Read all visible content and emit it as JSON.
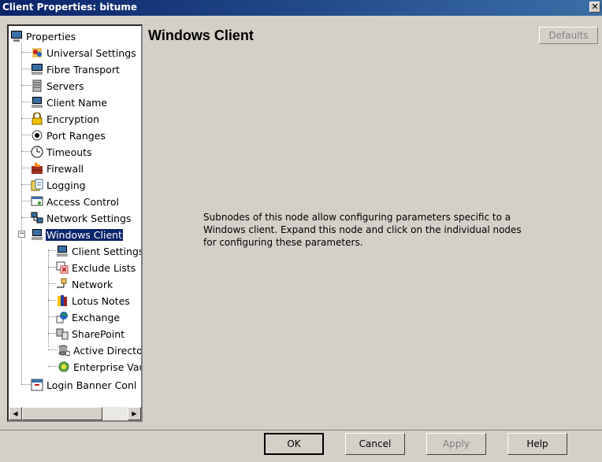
{
  "window": {
    "title": "Client Properties: bitume"
  },
  "tree": {
    "items": [
      {
        "label": "Properties",
        "icon": "computer-icon"
      },
      {
        "label": "Universal Settings",
        "icon": "settings-icon"
      },
      {
        "label": "Fibre Transport",
        "icon": "monitor-icon"
      },
      {
        "label": "Servers",
        "icon": "servers-icon"
      },
      {
        "label": "Client Name",
        "icon": "computer-icon"
      },
      {
        "label": "Encryption",
        "icon": "lock-icon"
      },
      {
        "label": "Port Ranges",
        "icon": "radio-icon"
      },
      {
        "label": "Timeouts",
        "icon": "clock-icon"
      },
      {
        "label": "Firewall",
        "icon": "firewall-icon"
      },
      {
        "label": "Logging",
        "icon": "log-icon"
      },
      {
        "label": "Access Control",
        "icon": "access-control-icon"
      },
      {
        "label": "Network Settings",
        "icon": "network-icon"
      },
      {
        "label": "Windows Client",
        "icon": "computer-icon"
      },
      {
        "label": "Client Settings",
        "icon": "computer-icon"
      },
      {
        "label": "Exclude Lists",
        "icon": "exclude-icon"
      },
      {
        "label": "Network",
        "icon": "network-plug-icon"
      },
      {
        "label": "Lotus Notes",
        "icon": "lotus-icon"
      },
      {
        "label": "Exchange",
        "icon": "exchange-icon"
      },
      {
        "label": "SharePoint",
        "icon": "sharepoint-icon"
      },
      {
        "label": "Active Directo",
        "icon": "active-directory-icon"
      },
      {
        "label": "Enterprise Vau",
        "icon": "enterprise-vault-icon"
      },
      {
        "label": "Login Banner Conl",
        "icon": "banner-icon"
      }
    ]
  },
  "main": {
    "title": "Windows Client",
    "defaults_label": "Defaults",
    "description": "Subnodes of this node allow configuring parameters specific to a Windows client. Expand this node and click on the individual nodes for configuring these parameters."
  },
  "buttons": {
    "ok": "OK",
    "cancel": "Cancel",
    "apply": "Apply",
    "help": "Help"
  },
  "colors": {
    "titlebar": "#0a246a",
    "selection": "#0a246a",
    "face": "#d4d0c8"
  }
}
